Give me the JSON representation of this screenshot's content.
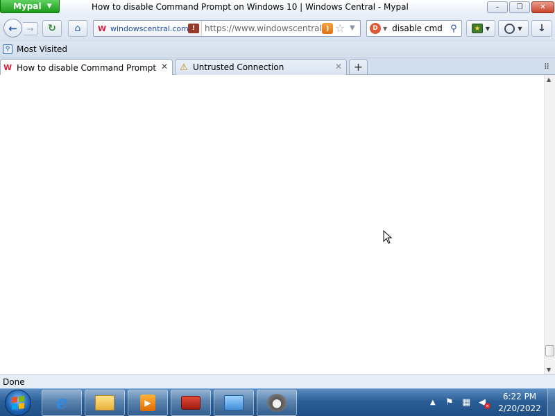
{
  "titlebar": {
    "app_menu_label": "Mypal",
    "window_title": "How to disable Command Prompt on Windows 10 | Windows Central - Mypal",
    "minimize_glyph": "–",
    "maximize_glyph": "❐",
    "close_glyph": "✕"
  },
  "navbar": {
    "site_identity": "windowscentral.com",
    "url": "https://www.windowscentral.c",
    "search_value": "disable cmd"
  },
  "bookmarks": {
    "most_visited": "Most Visited"
  },
  "tabs": [
    {
      "label": "How to disable Command Prompt o...",
      "favicon": "windows-central-w",
      "active": true
    },
    {
      "label": "Untrusted Connection",
      "favicon": "warning-icon",
      "active": false
    }
  ],
  "statusbar": {
    "text": "Done"
  },
  "taskbar": {
    "apps": [
      "start-button",
      "internet-explorer",
      "windows-explorer",
      "media-player",
      "toolbox",
      "control-panel",
      "raccoon-app"
    ],
    "clock_time": "6:22 PM",
    "clock_date": "2/20/2022"
  },
  "colors": {
    "app_button": "#1e9a1e",
    "taskbar": "#2a5e96",
    "favicon_w": "#d21f3c"
  }
}
